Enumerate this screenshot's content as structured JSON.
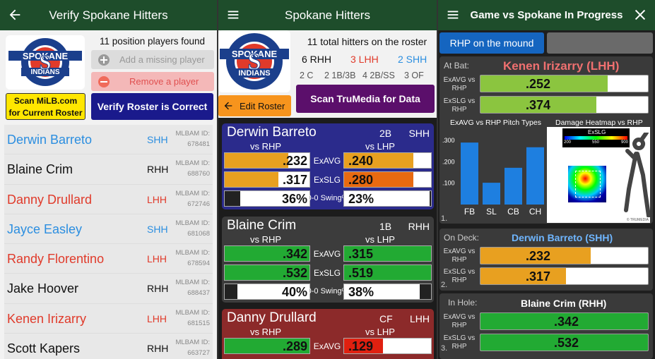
{
  "panel1": {
    "title": "Verify Spokane Hitters",
    "back_icon": "arrow-left-icon",
    "found_text": "11 position players found",
    "add_label": "Add a missing player",
    "remove_label": "Remove a player",
    "scan_line1": "Scan MiLB.com",
    "scan_line2": "for Current Roster",
    "verify_label": "Verify Roster is Correct",
    "id_label": "MLBAM ID:",
    "players": [
      {
        "name": "Derwin Barreto",
        "hand": "SHH",
        "id": "678481",
        "color": "#2b8ee0"
      },
      {
        "name": "Blaine Crim",
        "hand": "RHH",
        "id": "688760",
        "color": "#111111"
      },
      {
        "name": "Danny Drullard",
        "hand": "LHH",
        "id": "672746",
        "color": "#e03a2a"
      },
      {
        "name": "Jayce Easley",
        "hand": "SHH",
        "id": "681068",
        "color": "#2b8ee0"
      },
      {
        "name": "Randy Florentino",
        "hand": "LHH",
        "id": "678594",
        "color": "#e03a2a"
      },
      {
        "name": "Jake Hoover",
        "hand": "RHH",
        "id": "688437",
        "color": "#111111"
      },
      {
        "name": "Kenen Irizarry",
        "hand": "LHH",
        "id": "681515",
        "color": "#e03a2a"
      },
      {
        "name": "Scott Kapers",
        "hand": "RHH",
        "id": "663727",
        "color": "#111111"
      }
    ]
  },
  "logo": {
    "letter": "S",
    "top_text": "SPOKANE",
    "bottom_text": "INDIANS"
  },
  "panel2": {
    "title": "Spokane Hitters",
    "menu_icon": "hamburger-menu-icon",
    "total_text": "11 total hitters on the roster",
    "rhh": "6 RHH",
    "lhh": "3 LHH",
    "shh": "2 SHH",
    "c": "2 C",
    "inf1": "2 1B/3B",
    "inf2": "4 2B/SS",
    "of": "3 OF",
    "edit_label": "Edit Roster",
    "tm_label": "Scan TruMedia for Data",
    "vs_rhp": "vs RHP",
    "vs_lhp": "vs LHP",
    "exavg_label": "ExAVG",
    "exslg_label": "ExSLG",
    "swing_label": "0-0 Swing%",
    "cards": [
      {
        "name": "Derwin Barreto",
        "pos": "2B",
        "hand": "SHH",
        "bg": "#2b2b8c",
        "r_avg": ".232",
        "l_avg": ".240",
        "r_slg": ".317",
        "l_slg": ".280",
        "r_sw": "36%",
        "l_sw": "23%",
        "r_avg_pct": 0.75,
        "l_avg_pct": 0.8,
        "r_slg_pct": 0.63,
        "l_slg_pct": 0.8,
        "r_sw_pct": 0.18,
        "l_sw_pct": 0.02,
        "r_avg_col": "#e8a020",
        "l_avg_col": "#e8a020",
        "r_slg_col": "#e8a020",
        "l_slg_col": "#e86a10"
      },
      {
        "name": "Blaine Crim",
        "pos": "1B",
        "hand": "RHH",
        "bg": "#3c3c3c",
        "r_avg": ".342",
        "l_avg": ".315",
        "r_slg": ".532",
        "l_slg": ".519",
        "r_sw": "40%",
        "l_sw": "38%",
        "r_avg_pct": 1.0,
        "l_avg_pct": 1.0,
        "r_slg_pct": 1.0,
        "l_slg_pct": 1.0,
        "r_sw_pct": 0.15,
        "l_sw_pct": 0.13,
        "r_avg_col": "#22aa33",
        "l_avg_col": "#22aa33",
        "r_slg_col": "#22aa33",
        "l_slg_col": "#22aa33"
      },
      {
        "name": "Danny Drullard",
        "pos": "CF",
        "hand": "LHH",
        "bg": "#8c2a2a",
        "r_avg": ".289",
        "l_avg": ".129",
        "r_slg": "",
        "l_slg": "",
        "r_sw": "",
        "l_sw": "",
        "r_avg_pct": 1.0,
        "l_avg_pct": 0.45,
        "r_slg_pct": 0,
        "l_slg_pct": 0,
        "r_sw_pct": 0,
        "l_sw_pct": 0,
        "r_avg_col": "#22aa33",
        "l_avg_col": "#e02010",
        "r_slg_col": "#22aa33",
        "l_slg_col": "#e02010"
      }
    ]
  },
  "panel3": {
    "title": "Game vs Spokane In Progress",
    "close_icon": "close-icon",
    "rhp_label": "RHP on the mound",
    "at_bat_label": "At Bat:",
    "at_bat_name": "Kenen Irizarry (LHH)",
    "exavg_vs": "ExAVG vs RHP",
    "exslg_vs": "ExSLG vs RHP",
    "ab_avg": ".252",
    "ab_slg": ".374",
    "ab_avg_pct": 0.76,
    "ab_slg_pct": 0.69,
    "pitch_title": "ExAVG vs RHP Pitch Types",
    "heat_title": "Damage Heatmap vs RHP",
    "heat_legend": "ExSLG",
    "heat_ticks": [
      "200",
      "550",
      "900"
    ],
    "chart_data": {
      "type": "bar",
      "categories": [
        "FB",
        "SL",
        "CB",
        "CH"
      ],
      "values": [
        0.29,
        0.102,
        0.172,
        0.268
      ],
      "yticks": [
        ".300",
        ".200",
        ".100"
      ],
      "ylim": [
        0,
        0.33
      ]
    },
    "num1": "1.",
    "num2": "2.",
    "num3": "3.",
    "on_deck_label": "On Deck:",
    "on_deck_name": "Derwin Barreto (SHH)",
    "od_avg": ".232",
    "od_slg": ".317",
    "od_avg_pct": 0.66,
    "od_slg_pct": 0.51,
    "in_hole_label": "In Hole:",
    "in_hole_name": "Blaine Crim (RHH)",
    "ih_avg": ".342",
    "ih_slg": ".532",
    "ih_avg_pct": 1.0,
    "ih_slg_pct": 1.0,
    "orange": "#e8a020",
    "green": "#22aa33",
    "watermark": "© TRUMEDIA"
  }
}
